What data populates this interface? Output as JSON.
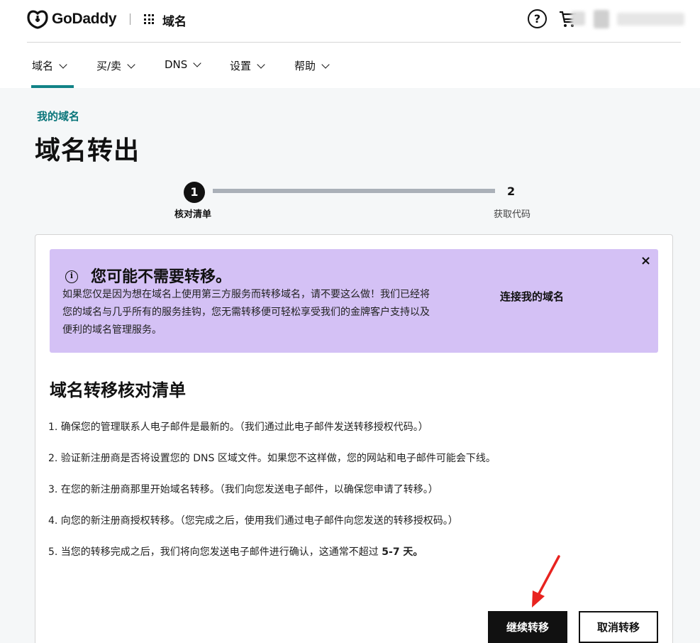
{
  "header": {
    "brand": "GoDaddy",
    "product": "域名",
    "help_symbol": "?"
  },
  "nav": {
    "items": [
      {
        "label": "域名",
        "active": true
      },
      {
        "label": "买/卖"
      },
      {
        "label": "DNS"
      },
      {
        "label": "设置"
      },
      {
        "label": "帮助"
      }
    ]
  },
  "breadcrumb": "我的域名",
  "page_title": "域名转出",
  "stepper": {
    "steps": [
      {
        "number": "1",
        "label": "核对清单",
        "active": true
      },
      {
        "number": "2",
        "label": "获取代码",
        "active": false
      }
    ]
  },
  "alert": {
    "title": "您可能不需要转移。",
    "body": "如果您仅是因为想在域名上使用第三方服务而转移域名，请不要这么做！我们已经将您的域名与几乎所有的服务挂钩，您无需转移便可轻松享受我们的金牌客户支持以及便利的域名管理服务。",
    "link": "连接我的域名",
    "close": "×"
  },
  "checklist": {
    "title": "域名转移核对清单",
    "items": [
      "1. 确保您的管理联系人电子邮件是最新的。（我们通过此电子邮件发送转移授权代码。）",
      "2. 验证新注册商是否将设置您的 DNS 区域文件。如果您不这样做，您的网站和电子邮件可能会下线。",
      "3. 在您的新注册商那里开始域名转移。（我们向您发送电子邮件，以确保您申请了转移。）",
      "4. 向您的新注册商授权转移。（您完成之后，使用我们通过电子邮件向您发送的转移授权码。）"
    ],
    "last_item_prefix": "5. 当您的转移完成之后，我们将向您发送电子邮件进行确认，这通常不超过 ",
    "last_item_bold": "5-7 天。"
  },
  "buttons": {
    "continue": "继续转移",
    "cancel": "取消转移"
  },
  "colors": {
    "accent": "#09757a",
    "alert_bg": "#d4c1f5",
    "annotation_arrow": "#e8231f"
  }
}
